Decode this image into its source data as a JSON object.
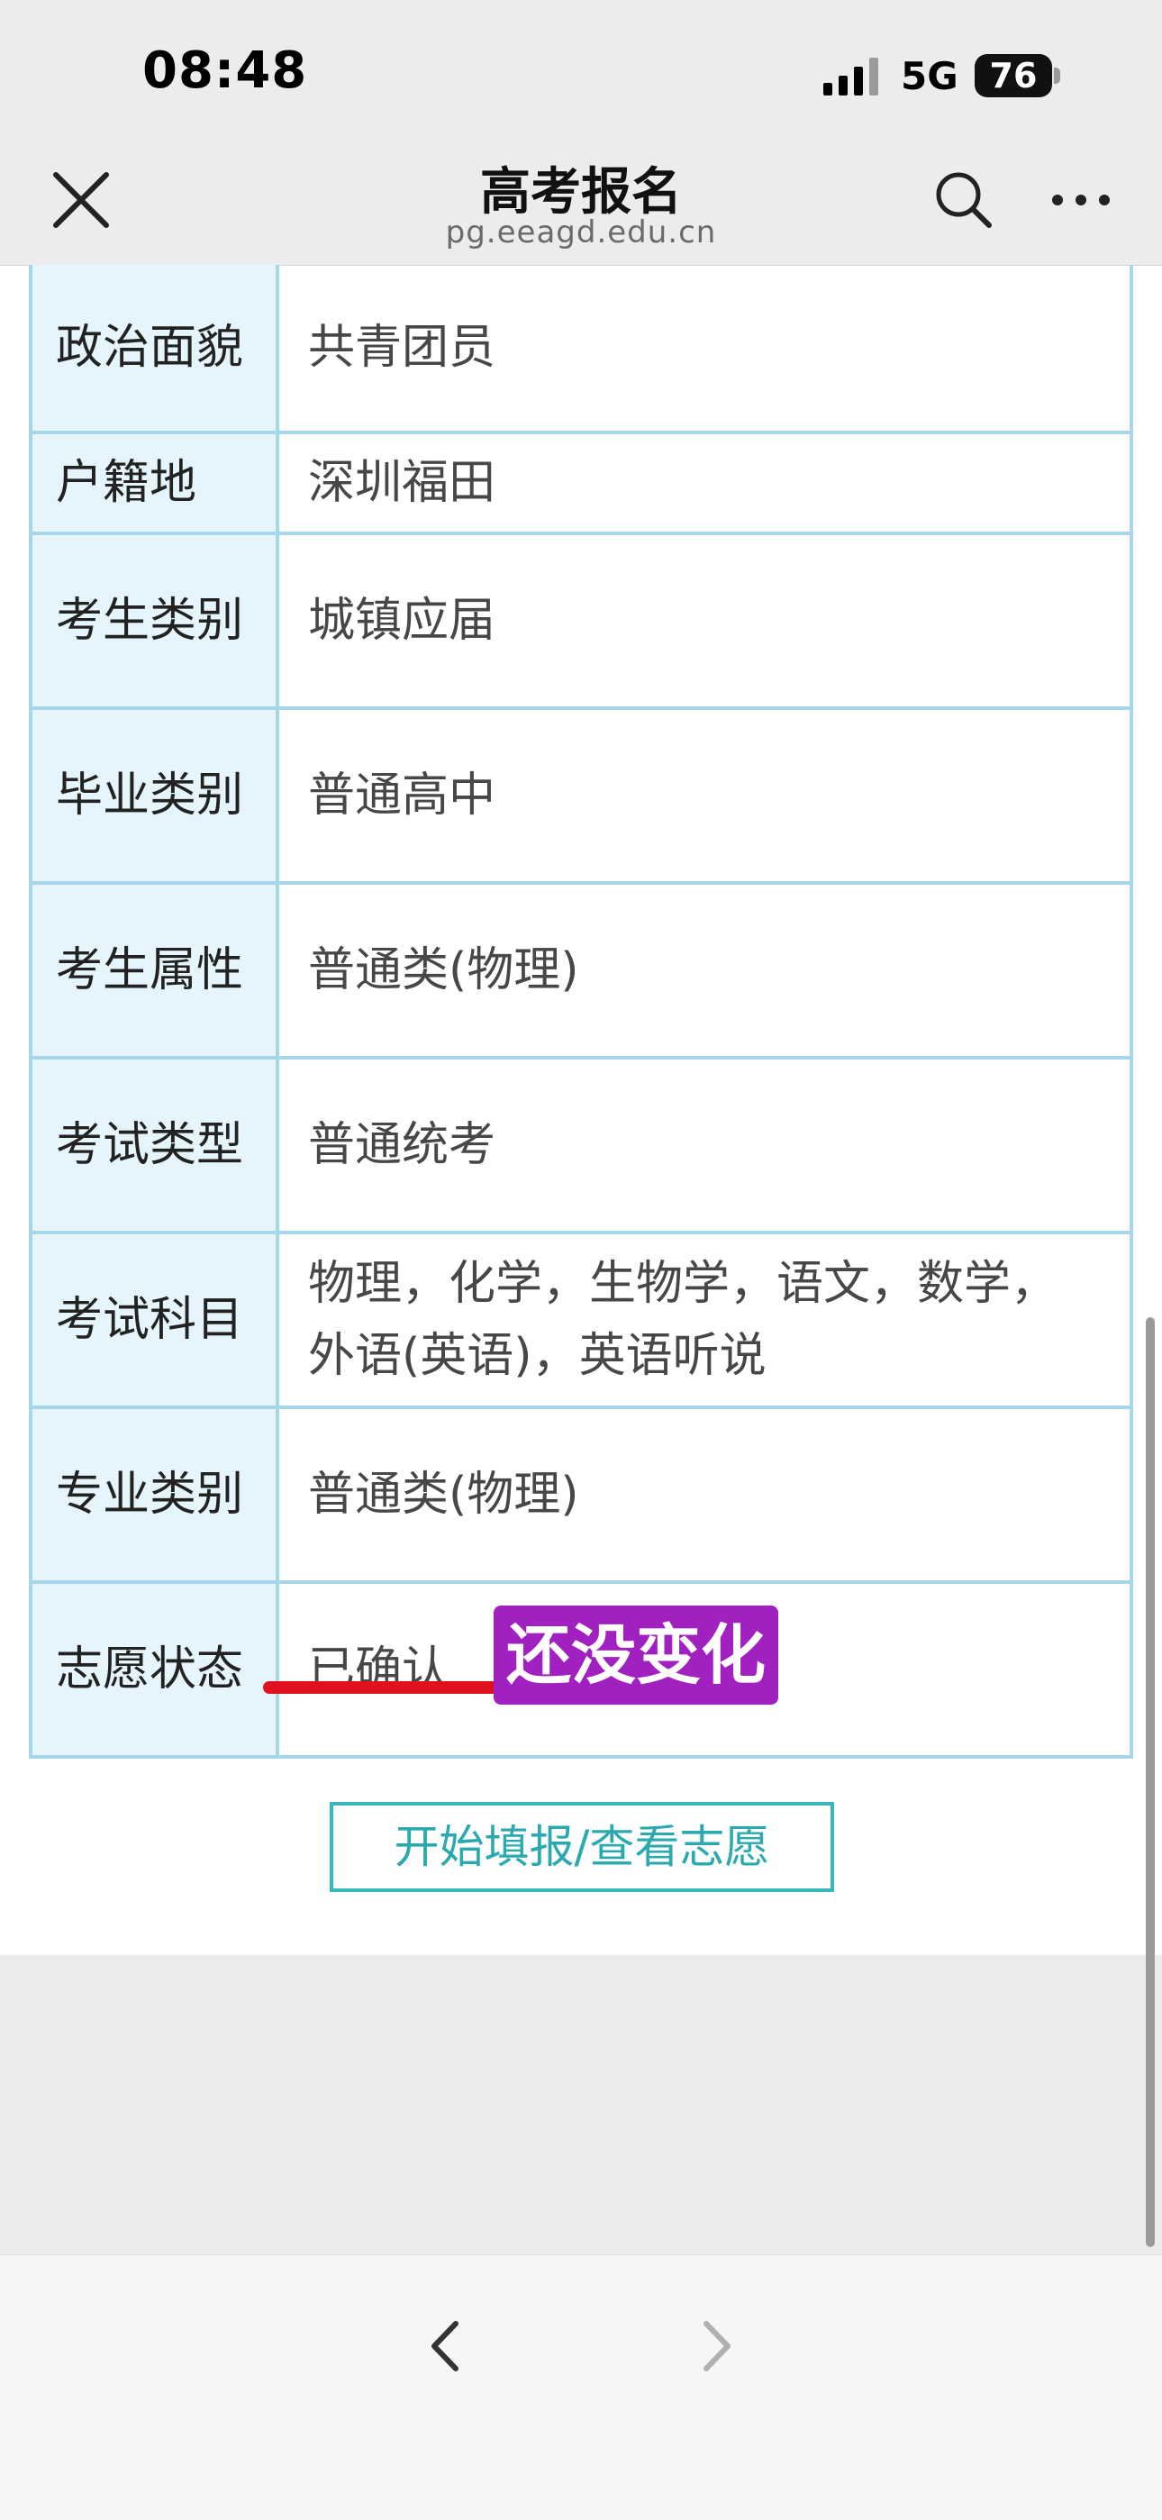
{
  "status_bar": {
    "time": "08:48",
    "network": "5G",
    "battery": "76"
  },
  "nav": {
    "title": "高考报名",
    "domain": "pg.eeagd.edu.cn",
    "icons": [
      "close-icon",
      "search-icon",
      "more-icon"
    ]
  },
  "rows": [
    {
      "label": "政治面貌",
      "value": "共青团员"
    },
    {
      "label": "户籍地",
      "value": "深圳福田"
    },
    {
      "label": "考生类别",
      "value": "城镇应届"
    },
    {
      "label": "毕业类别",
      "value": "普通高中"
    },
    {
      "label": "考生属性",
      "value": "普通类(物理)"
    },
    {
      "label": "考试类型",
      "value": "普通统考"
    },
    {
      "label": "考试科目",
      "value": "物理，化学，生物学，语文，数学，外语(英语)，英语听说"
    },
    {
      "label": "专业类别",
      "value": "普通类(物理)"
    },
    {
      "label": "志愿状态",
      "value": "已确认"
    }
  ],
  "annotation": {
    "text": "还没变化",
    "badge_color": "#a020c0",
    "underline_color": "#e0101e"
  },
  "action_button": {
    "label": "开始填报/查看志愿"
  },
  "bottom_nav": {
    "icons": [
      "back-arrow-icon",
      "forward-arrow-icon"
    ]
  },
  "colors": {
    "table_border": "#a6d6ea",
    "label_bg": "#e6f5fc",
    "accent": "#2aa9ae"
  }
}
